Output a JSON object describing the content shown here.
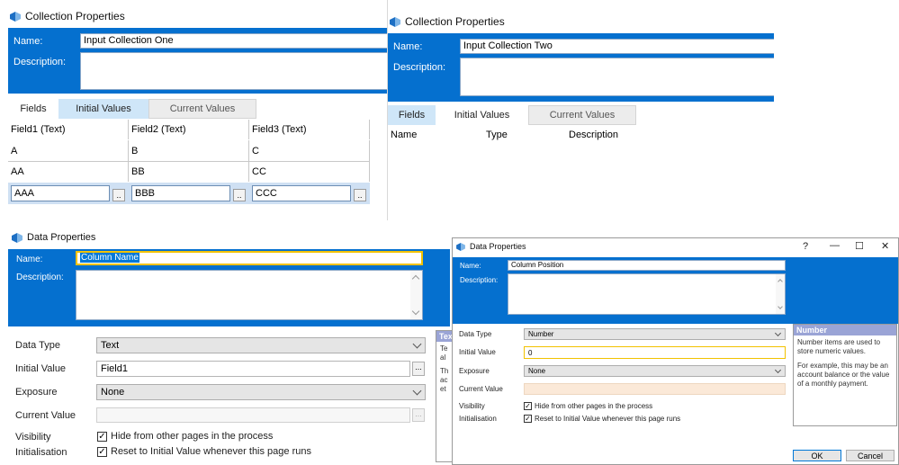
{
  "collection_one": {
    "title": "Collection Properties",
    "name_label": "Name:",
    "name_value": "Input Collection One",
    "description_label": "Description:",
    "tabs": [
      "Fields",
      "Initial Values",
      "Current Values"
    ],
    "columns": [
      "Field1  (Text)",
      "Field2  (Text)",
      "Field3  (Text)"
    ],
    "rows": [
      [
        "A",
        "B",
        "C"
      ],
      [
        "AA",
        "BB",
        "CC"
      ]
    ],
    "edit_row": [
      "AAA",
      "BBB",
      "CCC"
    ],
    "ellipsis": ".."
  },
  "collection_two": {
    "title": "Collection Properties",
    "name_label": "Name:",
    "name_value": "Input Collection Two",
    "description_label": "Description:",
    "tabs": [
      "Fields",
      "Initial Values",
      "Current Values"
    ],
    "columns": [
      "Name",
      "Type",
      "Description"
    ]
  },
  "data_one": {
    "title": "Data Properties",
    "name_label": "Name:",
    "name_value": "Column Name",
    "description_label": "Description:",
    "data_type_label": "Data Type",
    "data_type_value": "Text",
    "initial_value_label": "Initial Value",
    "initial_value": "Field1",
    "exposure_label": "Exposure",
    "exposure_value": "None",
    "current_value_label": "Current Value",
    "visibility_label": "Visibility",
    "visibility_text": "Hide from other pages in the process",
    "initialisation_label": "Initialisation",
    "initialisation_text": "Reset to Initial Value whenever this page runs",
    "ellipsis": "..."
  },
  "data_one_help_fragment": {
    "header": "Tex",
    "line1": "Te",
    "line2": "al",
    "line3": "Th",
    "line4": "ac",
    "line5": "et"
  },
  "data_two": {
    "title": "Data Properties",
    "help_button": "?",
    "minimize": "—",
    "maximize": "☐",
    "close": "✕",
    "name_label": "Name:",
    "name_value": "Column Position",
    "description_label": "Description:",
    "data_type_label": "Data Type",
    "data_type_value": "Number",
    "initial_value_label": "Initial Value",
    "initial_value": "0",
    "exposure_label": "Exposure",
    "exposure_value": "None",
    "current_value_label": "Current Value",
    "visibility_label": "Visibility",
    "visibility_text": "Hide from other pages in the process",
    "initialisation_label": "Initialisation",
    "initialisation_text": "Reset to Initial Value whenever this page runs",
    "help_header": "Number",
    "help_text_1": "Number items are used to store numeric values.",
    "help_text_2": "For example, this may be an account balance or the value of a monthly payment.",
    "ok_button": "OK",
    "cancel_button": "Cancel",
    "check_mark": "✓"
  },
  "colors": {
    "header_blue": "#0570cf",
    "tab_selected": "#cfe6f8",
    "focus_yellow": "#f2c200",
    "help_header": "#9aa4d6",
    "current_value_bg": "#fbe9d8"
  },
  "icons": [
    "data-item-icon"
  ]
}
